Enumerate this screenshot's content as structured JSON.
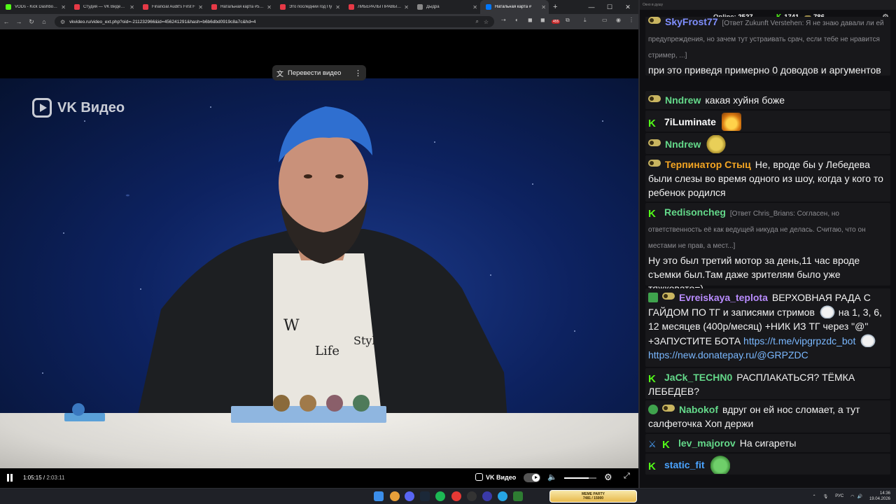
{
  "browser": {
    "tabs": [
      {
        "label": "VODs - Kick Dashboard",
        "color": "#53fc18"
      },
      {
        "label": "Студия — VK Видео Live",
        "color": "#e63946"
      },
      {
        "label": "Financial Audit's First F",
        "color": "#e63946"
      },
      {
        "label": "Натальная карта #58 А",
        "color": "#e63946"
      },
      {
        "label": "Это последний год Пу",
        "color": "#e63946"
      },
      {
        "label": "ЛИБЕРАЛЫ ПРАВЫ В?",
        "color": "#e63946"
      },
      {
        "label": "Дыдра",
        "color": "#888888"
      },
      {
        "label": "Натальная карта #",
        "color": "#0077ff"
      }
    ],
    "url": "vkvideo.ru/video_ext.php?oid=-211232966&id=456241291&hash=b6b6dbd0919c8a7c&hd=4",
    "badge_count": "455"
  },
  "player": {
    "watermark": "VK Видео",
    "translate_label": "Перевести видео",
    "time_current": "1:05:15",
    "time_total": "2:03:11",
    "brand": "VK Видео",
    "volume": 0.75
  },
  "chat": {
    "window_title": "Окно в душу",
    "online_label": "Online:",
    "online_count": "2527",
    "count_a": "1741",
    "count_b": "786",
    "messages": [
      {
        "user": "SkyFrost77",
        "user_color": "#7f8fff",
        "reply": "[Ответ Zukunft Verstehen: Я не знаю давали ли ей предупреждения, но зачем тут устраивать срач, если тебе не нравится стример, ...]",
        "text": "при это приведя примерно 0 доводов и аргументов"
      },
      {
        "user": "Nndrew",
        "user_color": "#64d98a",
        "text": "какая хуйня боже"
      },
      {
        "user": "7iLuminate",
        "user_color": "#ffffff",
        "text": ""
      },
      {
        "user": "Nndrew",
        "user_color": "#64d98a",
        "text": ""
      },
      {
        "user": "Терпинатор Стыц",
        "user_color": "#f5a623",
        "text": "Не, вроде бы у Лебедева были слезы во время одного из шоу, когда у кого то ребенок родился"
      },
      {
        "user": "Redisoncheg",
        "user_color": "#64d98a",
        "reply": "[Ответ Chris_Brians: Согласен, но ответственность её как ведущей никуда не делась. Считаю, что он местами не прав, а мест...]",
        "text": "Ну это был третий мотор за день,11 час вроде съемки был.Там даже зрителям было уже тяжковато=)"
      },
      {
        "user": "Evreiskaya_teplota",
        "user_color": "#b98cff",
        "text_a": "ВЕРХОВНАЯ РАДА С ГАЙДОМ ПО ТГ и записями стримов",
        "text_b": "на 1, 3, 6, 12 месяцев (400р/месяц) +НИК ИЗ ТГ через \"@\" +ЗАПУСТИТЕ БОТА",
        "link1": "https://t.me/vipgrpzdc_bot",
        "link2": "https://new.donatepay.ru/@GRPZDC"
      },
      {
        "user": "JaCk_TECHN0",
        "user_color": "#64d98a",
        "text": "РАСПЛАКАТЬСЯ? ТЁМКА ЛЕБЕДЕВ?"
      },
      {
        "user": "Nabokof",
        "user_color": "#64d98a",
        "text": "вдруг он ей нос сломает, а тут салфеточка Хоп держи"
      },
      {
        "user": "lev_majorov",
        "user_color": "#64d98a",
        "text": "На сигареты"
      },
      {
        "user": "static_fit",
        "user_color": "#4aa3ff",
        "text": ""
      }
    ]
  },
  "taskbar": {
    "party_title": "MEME PARTY",
    "party_progress": "7481 / 15000",
    "lang": "РУС",
    "time": "14:36",
    "date": "19.04.2026"
  }
}
